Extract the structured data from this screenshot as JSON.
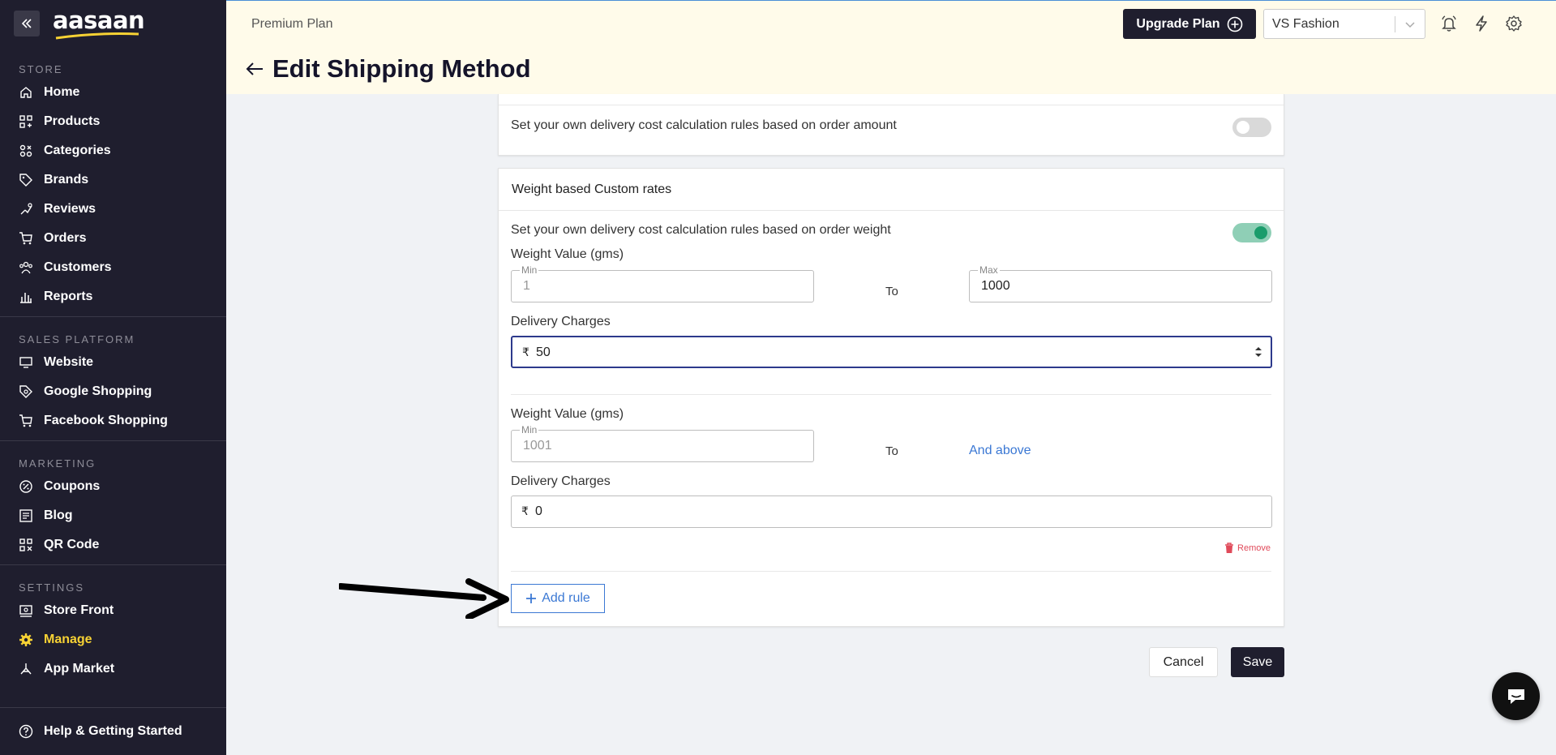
{
  "sidebar": {
    "logo": "aasaan",
    "sections": [
      {
        "title": "STORE",
        "items": [
          "Home",
          "Products",
          "Categories",
          "Brands",
          "Reviews",
          "Orders",
          "Customers",
          "Reports"
        ]
      },
      {
        "title": "SALES PLATFORM",
        "items": [
          "Website",
          "Google Shopping",
          "Facebook Shopping"
        ]
      },
      {
        "title": "MARKETING",
        "items": [
          "Coupons",
          "Blog",
          "QR Code"
        ]
      },
      {
        "title": "SETTINGS",
        "items": [
          "Store Front",
          "Manage",
          "App Market"
        ]
      }
    ],
    "active_item": "Manage",
    "help": "Help & Getting Started"
  },
  "header": {
    "plan": "Premium Plan",
    "title": "Edit Shipping Method",
    "upgrade_label": "Upgrade Plan",
    "store_name": "VS Fashion"
  },
  "order_amount": {
    "description": "Set your own delivery cost calculation rules based on order amount",
    "enabled": false
  },
  "weight_rates": {
    "heading": "Weight based Custom rates",
    "description": "Set your own delivery cost calculation rules based on order weight",
    "enabled": true,
    "weight_label": "Weight Value (gms)",
    "charges_label": "Delivery Charges",
    "to_label": "To",
    "min_legend": "Min",
    "max_legend": "Max",
    "currency": "₹",
    "rules": [
      {
        "min": "1",
        "max": "1000",
        "charge": "50"
      },
      {
        "min": "1001",
        "max_text": "And above",
        "charge": "0"
      }
    ],
    "remove_label": "Remove",
    "add_rule_label": "Add rule"
  },
  "footer": {
    "cancel_label": "Cancel",
    "save_label": "Save"
  },
  "colors": {
    "sidebar_bg": "#1f1e2e",
    "header_bg": "#fffbea",
    "active": "#f7d234",
    "link": "#3b78d4",
    "toggle_on": "#1a9c6b",
    "danger": "#e04a5a"
  }
}
